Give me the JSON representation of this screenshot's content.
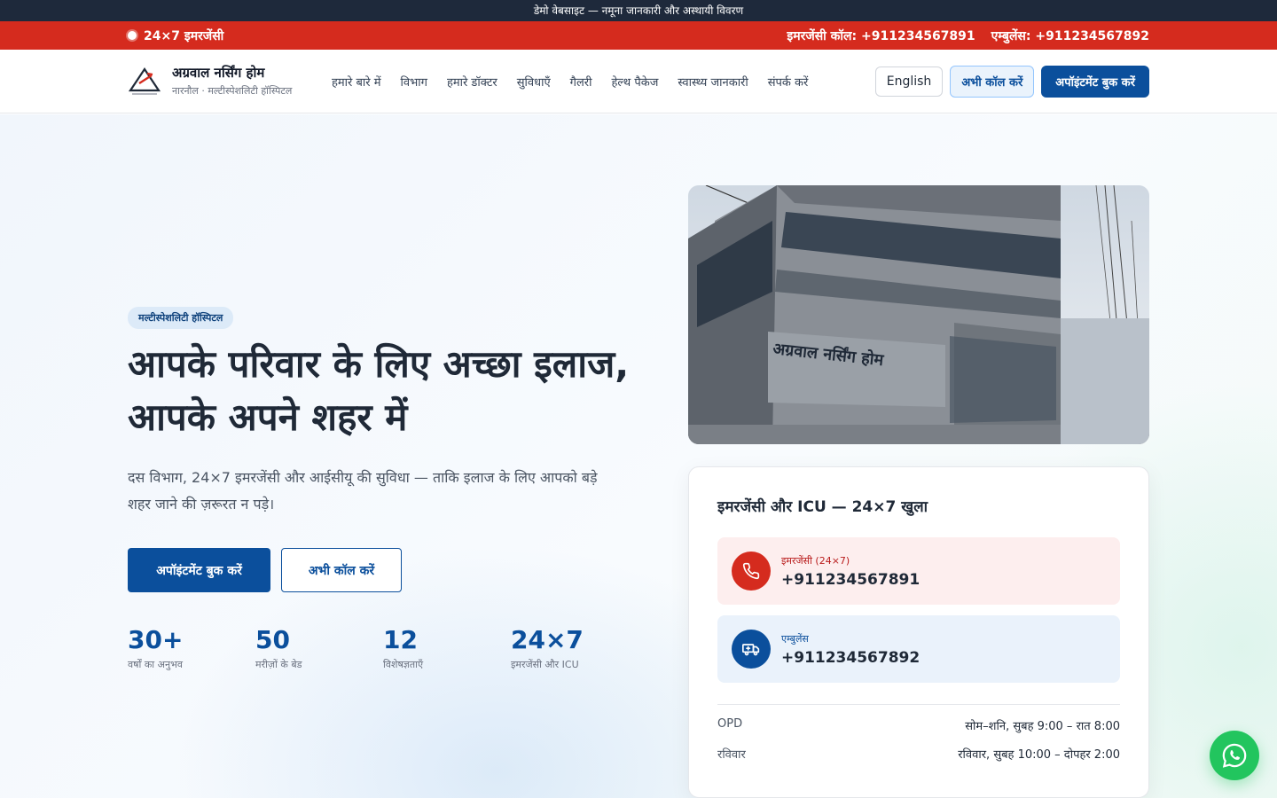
{
  "demo_strip": {
    "text": "डेमो वेबसाइट — नमूना जानकारी और अस्थायी विवरण"
  },
  "emergency_bar": {
    "label": "24×7 इमरजेंसी",
    "emergency_call": "इमरजेंसी कॉल: +911234567891",
    "ambulance": "एम्बुलेंस: +911234567892",
    "color": "#d52b1e"
  },
  "header": {
    "brand_name": "अग्रवाल नर्सिंग होम",
    "brand_sub": "नारनौल · मल्टीस्पेशलिटी हॉस्पिटल",
    "nav": [
      {
        "label": "हमारे बारे में"
      },
      {
        "label": "विभाग"
      },
      {
        "label": "हमारे डॉक्टर"
      },
      {
        "label": "सुविधाएँ"
      },
      {
        "label": "गैलरी"
      },
      {
        "label": "हेल्थ पैकेज"
      },
      {
        "label": "स्वास्थ्य जानकारी"
      },
      {
        "label": "संपर्क करें"
      }
    ],
    "lang_button": "English",
    "call_button": "अभी कॉल करें",
    "book_button": "अपॉइंटमेंट बुक करें"
  },
  "hero": {
    "tag": "मल्टीस्पेशलिटी हॉस्पिटल",
    "headline": "आपके परिवार के लिए अच्छा इलाज, आपके अपने शहर में",
    "lead": "दस विभाग, 24×7 इमरजेंसी और आईसीयू की सुविधा — ताकि इलाज के लिए आपको बड़े शहर जाने की ज़रूरत न पड़े।",
    "book_button": "अपॉइंटमेंट बुक करें",
    "call_button": "अभी कॉल करें",
    "stats": [
      {
        "value": "30+",
        "label": "वर्षों का अनुभव"
      },
      {
        "value": "50",
        "label": "मरीज़ों के बेड"
      },
      {
        "value": "12",
        "label": "विशेषज्ञताएँ"
      },
      {
        "value": "24×7",
        "label": "इमरजेंसी और ICU"
      }
    ]
  },
  "photo": {
    "sign_text": "अग्रवाल नर्सिंग होम"
  },
  "emergency_card": {
    "title": "इमरजेंसी और ICU — 24×7 खुला",
    "contacts": [
      {
        "label": "इमरजेंसी (24×7)",
        "number": "+911234567891",
        "icon": "phone-icon"
      },
      {
        "label": "एम्बुलेंस",
        "number": "+911234567892",
        "icon": "ambulance-icon"
      }
    ],
    "hours": [
      {
        "label": "OPD",
        "value": "सोम–शनि, सुबह 9:00 – रात 8:00"
      },
      {
        "label": "रविवार",
        "value": "रविवार, सुबह 10:00 – दोपहर 2:00"
      }
    ]
  },
  "colors": {
    "primary": "#0b4f9c",
    "emergency": "#d52b1e",
    "whatsapp": "#22c55e"
  }
}
